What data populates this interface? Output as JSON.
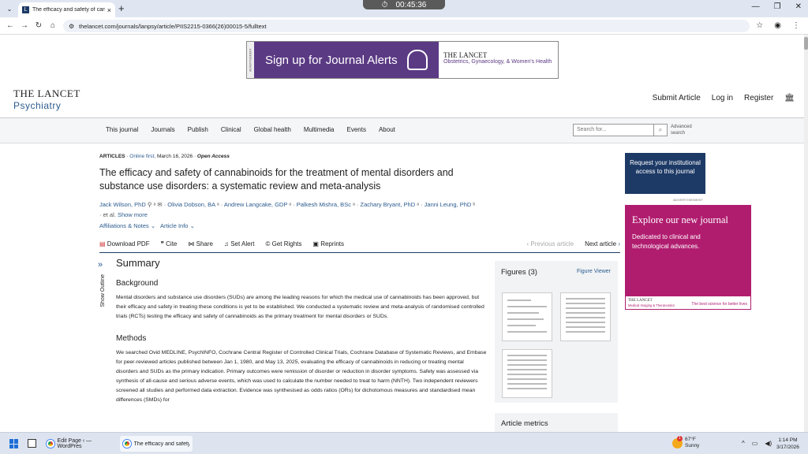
{
  "browser": {
    "tab_title": "The efficacy and safety of cannab",
    "tab_favicon": "L",
    "timer": "00:45:36",
    "url": "thelancet.com/journals/lanpsy/article/PIIS2215-0366(26)00015-5/fulltext"
  },
  "ad_top": {
    "strip": "ADVERTISEMENT",
    "headline": "Sign up for Journal Alerts",
    "brand": "THE LANCET",
    "brand_sub": "Obstetrics, Gynaecology, & Women's Health",
    "color": "#5b3a84"
  },
  "header": {
    "logo_main": "THE LANCET",
    "logo_sub": "Psychiatry",
    "links": [
      "Submit Article",
      "Log in",
      "Register"
    ]
  },
  "nav": {
    "items": [
      "This journal",
      "Journals",
      "Publish",
      "Clinical",
      "Global health",
      "Multimedia",
      "Events",
      "About"
    ],
    "search_placeholder": "Search for...",
    "advanced_1": "Advanced",
    "advanced_2": "search"
  },
  "article": {
    "type": "ARTICLES",
    "online_first": "Online first,",
    "date": "March 16, 2026",
    "open_access": "Open Access",
    "title": "The efficacy and safety of cannabinoids for the treatment of mental disorders and substance use disorders: a systematic review and meta-analysis",
    "authors": [
      "Jack Wilson, PhD",
      "Olivia Dobson, BA",
      "Andrew Langcake, GDP",
      "Palkesh Mishra, BSc",
      "Zachary Bryant, PhD",
      "Janni Leung, PhD"
    ],
    "et_al": "et al.",
    "show_more": "Show more",
    "affiliations": "Affiliations & Notes",
    "article_info": "Article Info",
    "tools": [
      "Download PDF",
      "Cite",
      "Share",
      "Set Alert",
      "Get Rights",
      "Reprints"
    ],
    "prev": "Previous article",
    "next": "Next article"
  },
  "outline": {
    "label": "Show Outline"
  },
  "summary": {
    "heading": "Summary",
    "background_heading": "Background",
    "background_text": "Mental disorders and substance use disorders (SUDs) are among the leading reasons for which the medical use of cannabinoids has been approved, but their efficacy and safety in treating these conditions is yet to be established. We conducted a systematic review and meta-analysis of randomised controlled trials (RCTs) testing the efficacy and safety of cannabinoids as the primary treatment for mental disorders or SUDs.",
    "methods_heading": "Methods",
    "methods_text": "We searched Ovid MEDLINE, PsychINFO, Cochrane Central Register of Controlled Clinical Trials, Cochrane Database of Systematic Reviews, and Embase for peer-reviewed articles published between Jan 1, 1980, and May 13, 2025, evaluating the efficacy of cannabinoids in reducing or treating mental disorders and SUDs as the primary indication. Primary outcomes were remission of disorder or reduction in disorder symptoms. Safety was assessed via synthesis of all-cause and serious adverse events, which was used to calculate the number needed to treat to harm (NNTH). Two independent reviewers screened all studies and performed data extraction. Evidence was synthesised as odds ratios (ORs) for dichotomous measures and standardised mean differences (SMDs) for"
  },
  "figures": {
    "heading": "Figures (3)",
    "viewer": "Figure Viewer"
  },
  "metrics": {
    "heading": "Article metrics"
  },
  "sidebar": {
    "request_access": "Request your institutional access to this journal",
    "ad_label": "ADVERTISEMENT",
    "ad_headline": "Explore our new journal",
    "ad_text": "Dedicated to clinical and technological advances.",
    "ad_brand": "THE LANCET",
    "ad_brand_sub": "Medical Imaging & Theranostics",
    "ad_tagline": "The best science for better lives",
    "ad_color": "#b01d6f"
  },
  "taskbar": {
    "app1": "Edit Page ‹ — WordPres",
    "app2": "The efficacy and safety (",
    "weather_temp": "67°F",
    "weather_desc": "Sunny",
    "weather_badge": "1",
    "time": "1:14 PM",
    "date": "3/17/2026"
  }
}
